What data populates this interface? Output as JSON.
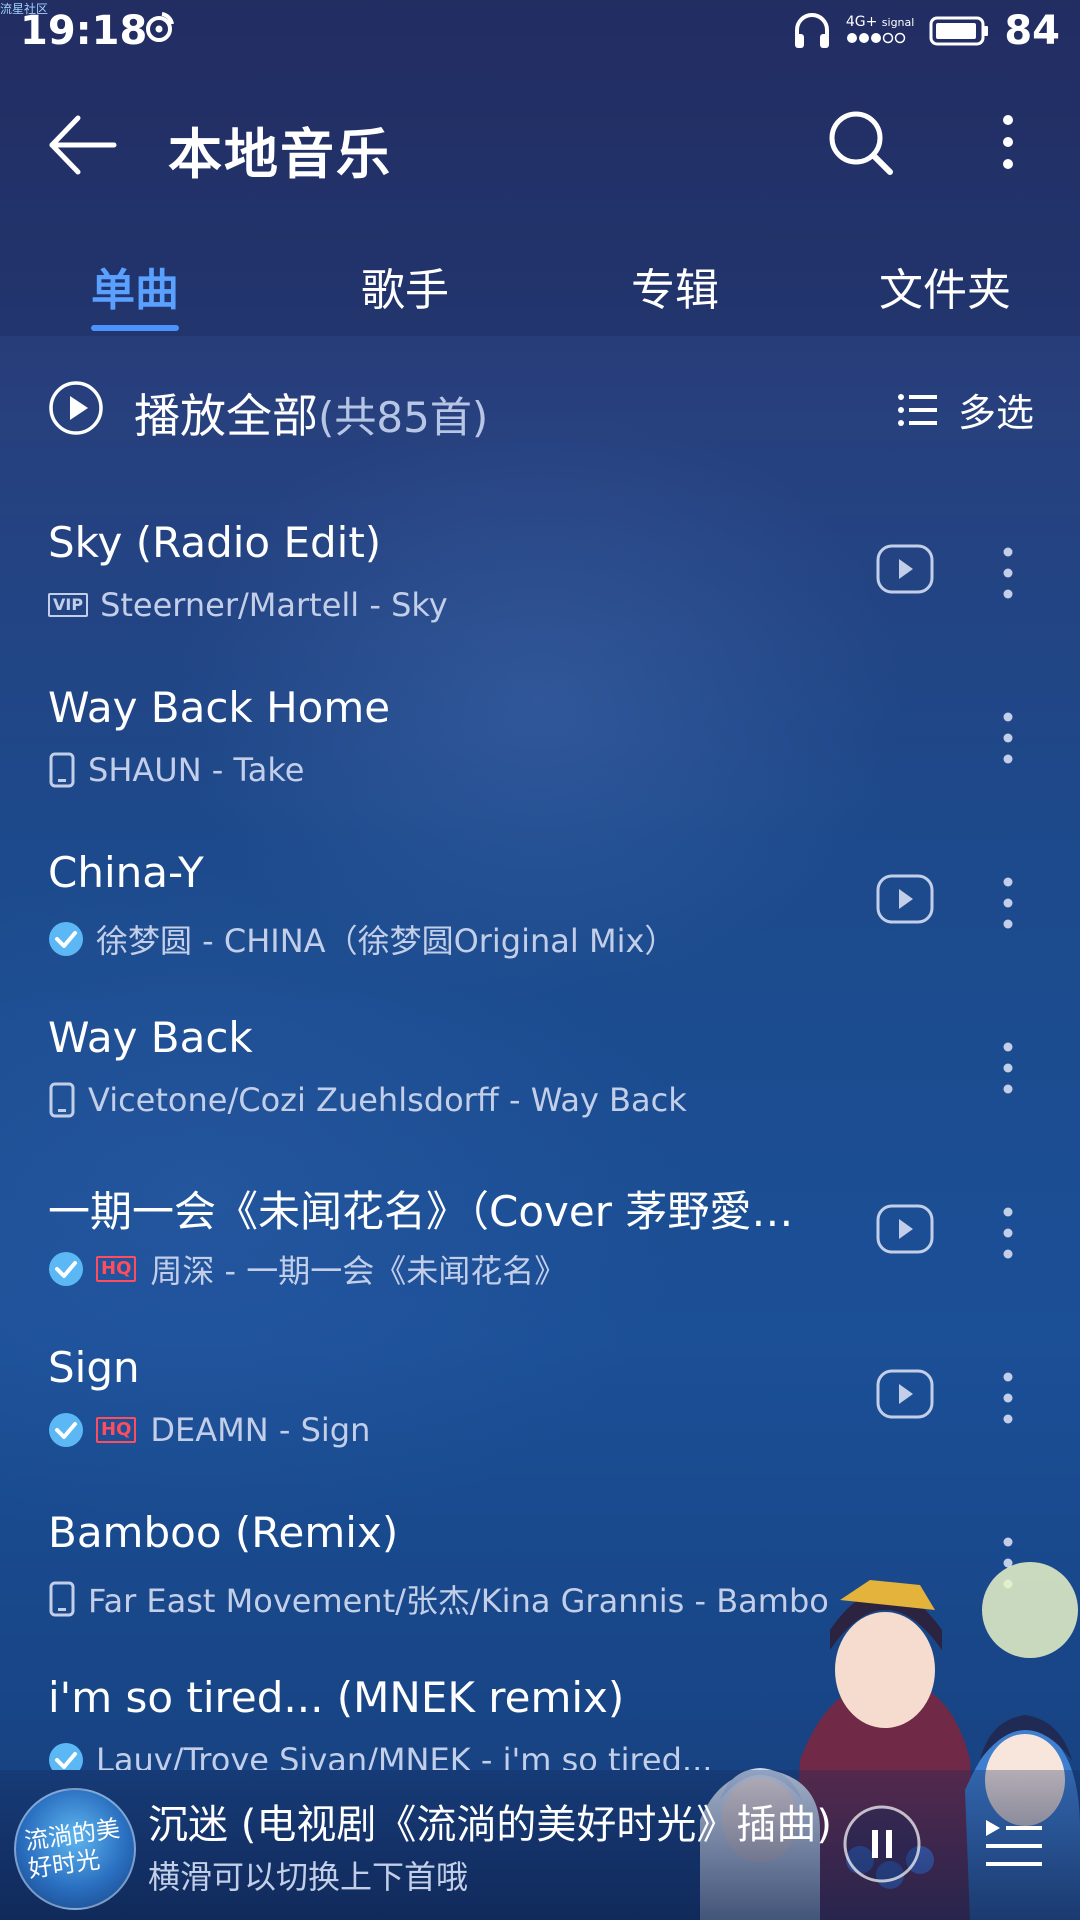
{
  "watermark": "流星社区",
  "status_bar": {
    "time": "19:18",
    "network_type": "4G+",
    "signal_label": "signal",
    "battery": "84"
  },
  "header": {
    "title": "本地音乐"
  },
  "tabs": [
    {
      "label": "单曲",
      "active": true
    },
    {
      "label": "歌手",
      "active": false
    },
    {
      "label": "专辑",
      "active": false
    },
    {
      "label": "文件夹",
      "active": false
    }
  ],
  "play_all": {
    "label": "播放全部",
    "count": "(共85首)",
    "multi_select": "多选"
  },
  "songs": [
    {
      "title": "Sky (Radio Edit)",
      "badge": "VIP",
      "subtitle": "Steerner/Martell - Sky",
      "has_mv": true
    },
    {
      "title": "Way Back Home",
      "source_icon": "phone-icon",
      "subtitle": "SHAUN - Take",
      "has_mv": false
    },
    {
      "title": "China-Y",
      "source_icon": "downloaded-check-icon",
      "subtitle": "徐梦圆 - CHINA（徐梦圆Original Mix）",
      "has_mv": true
    },
    {
      "title": "Way Back",
      "source_icon": "phone-icon",
      "subtitle": "Vicetone/Cozi Zuehlsdorff - Way Back",
      "has_mv": false
    },
    {
      "title": "一期一会《未闻花名》（Cover 茅野愛…",
      "source_icon": "downloaded-check-icon",
      "badge": "HQ",
      "subtitle": "周深 - 一期一会《未闻花名》",
      "has_mv": true
    },
    {
      "title": "Sign",
      "source_icon": "downloaded-check-icon",
      "badge": "HQ",
      "subtitle": "DEAMN - Sign",
      "has_mv": true
    },
    {
      "title": "Bamboo (Remix)",
      "source_icon": "phone-icon",
      "subtitle": "Far East Movement/张杰/Kina Grannis - Bambo",
      "has_mv": false
    },
    {
      "title": "i'm so tired... (MNEK remix)",
      "source_icon": "downloaded-check-icon",
      "subtitle": "Lauv/Troye Sivan/MNEK - i'm so tired...",
      "has_mv": false
    }
  ],
  "player": {
    "cover_text": "流淌的美好时光",
    "now_playing": "沉迷 (电视剧《流淌的美好时光》插曲)",
    "hint": "横滑可以切换上下首哦"
  },
  "colors": {
    "accent": "#4d93ff",
    "hq_badge": "#ff4d5e",
    "check": "#5bb8f5",
    "subtitle": "#c3cfe9"
  }
}
